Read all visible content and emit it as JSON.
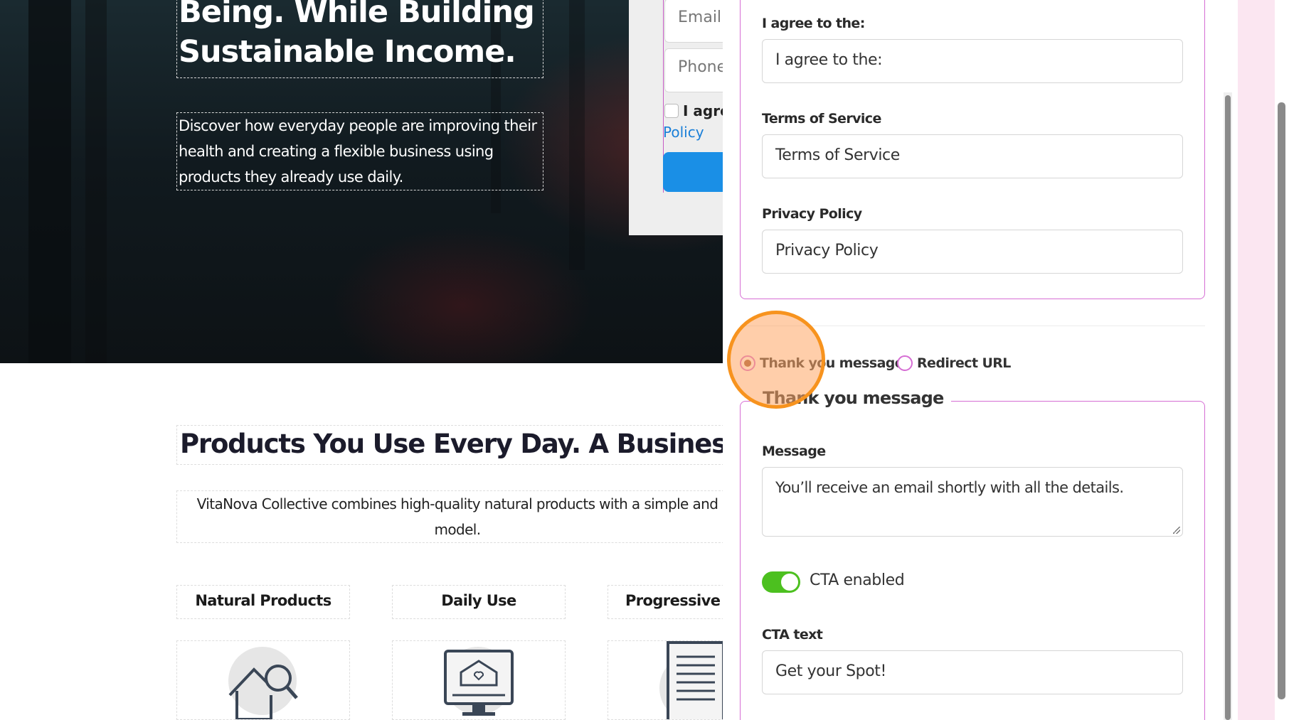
{
  "landing": {
    "hero_headline_line1": "Being. While Building a",
    "hero_headline_line2": "Sustainable Income.",
    "hero_subtext": "Discover how everyday people are improving their health and creating a flexible business using products they already use daily.",
    "form": {
      "email_placeholder": "Email",
      "phone_placeholder": "Phone",
      "agree_text": "I agree",
      "policy_link": "Policy"
    },
    "section_title": "Products You Use Every Day. A Business Th",
    "section_desc_line1": "VitaNova Collective combines high-quality natural products with a simple and",
    "section_desc_line2": "model.",
    "features": [
      {
        "label": "Natural Products",
        "icon": "house-search-icon"
      },
      {
        "label": "Daily Use",
        "icon": "monitor-home-icon"
      },
      {
        "label": "Progressive In",
        "icon": "document-icon"
      }
    ]
  },
  "panel": {
    "consent_fields": [
      {
        "label": "I agree to the:",
        "value": "I agree to the:"
      },
      {
        "label": "Terms of Service",
        "value": "Terms of Service"
      },
      {
        "label": "Privacy Policy",
        "value": "Privacy Policy"
      }
    ],
    "after_submit": {
      "options": [
        {
          "label": "Thank you message",
          "checked": true
        },
        {
          "label": "Redirect URL",
          "checked": false
        }
      ]
    },
    "thank_you": {
      "legend": "Thank you message",
      "message_label": "Message",
      "message_value": "You’ll receive an email shortly with all the details.",
      "cta_toggle_label": "CTA enabled",
      "cta_enabled": true,
      "cta_text_label": "CTA text",
      "cta_text_value": "Get your Spot!"
    }
  },
  "colors": {
    "accent_border": "#d66ed4",
    "toggle_on": "#4cc01f",
    "highlight": "#f7931e",
    "link": "#1a7fd8",
    "submit_button": "#1a8fe6"
  }
}
